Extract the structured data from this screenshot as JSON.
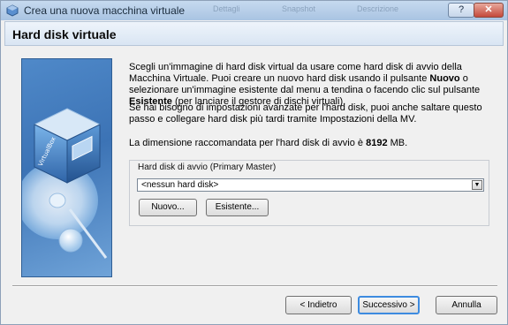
{
  "window": {
    "title": "Crea una nuova macchina virtuale",
    "help_label": "?",
    "close_label": "✕"
  },
  "background_tabs": [
    "Dettagli",
    "Snapshot",
    "Descrizione"
  ],
  "header": {
    "title": "Hard disk virtuale"
  },
  "description": {
    "paragraph1_a": "Scegli un'immagine di hard disk virtual da usare come hard disk di avvio della Macchina Virtuale. Puoi creare un nuovo hard disk usando il pulsante ",
    "paragraph1_b": "Nuovo",
    "paragraph1_c": " o selezionare un'immagine esistente dal menu a tendina o facendo clic sul pulsante ",
    "paragraph1_d": "Esistente",
    "paragraph1_e": " (per lanciare il gestore di dischi virtuali).",
    "paragraph2": "Se hai bisogno di impostazioni avanzate per l'hard disk, puoi anche saltare questo passo e collegare hard disk più tardi tramite Impostazioni della MV.",
    "recommended_a": "La dimensione raccomandata per l'hard disk di avvio è ",
    "recommended_value": "8192",
    "recommended_unit": " MB."
  },
  "boot_disk_group": {
    "label": "Hard disk di avvio (Primary Master)",
    "selected": "<nessun hard disk>",
    "new_button": "Nuovo...",
    "existing_button": "Esistente..."
  },
  "footer": {
    "back_button": "< Indietro",
    "next_button": "Successivo >",
    "cancel_button": "Annulla"
  },
  "colors": {
    "accent": "#3d8be0",
    "side_panel": "#3c73b5"
  }
}
